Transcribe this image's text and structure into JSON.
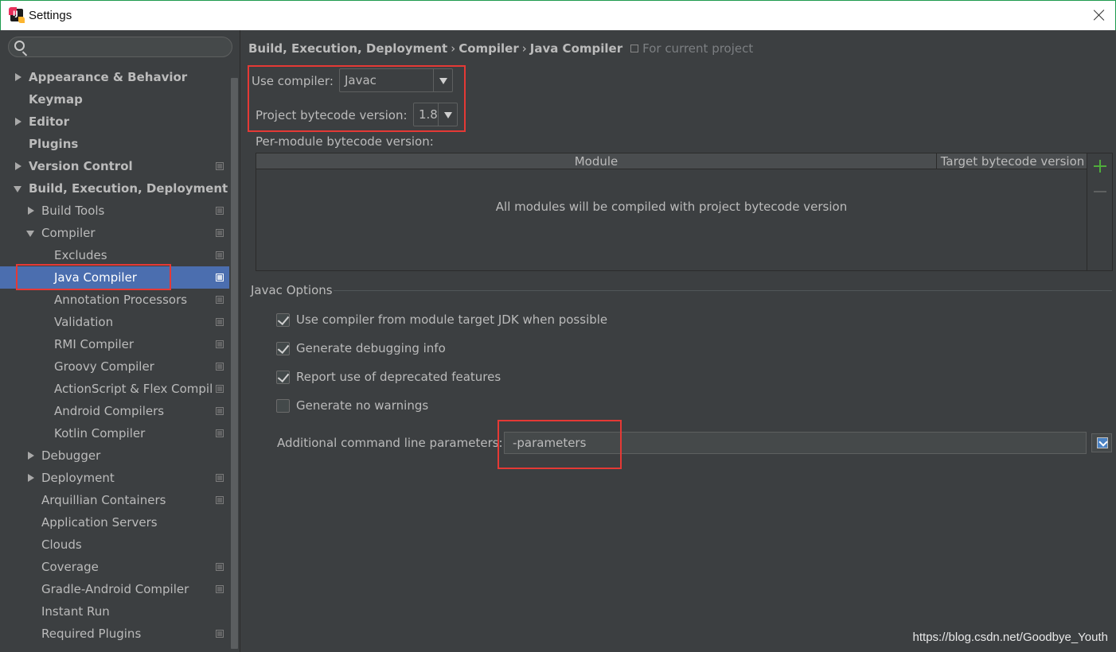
{
  "window": {
    "title": "Settings"
  },
  "search": {
    "placeholder": ""
  },
  "tree": [
    {
      "label": "Appearance & Behavior",
      "level": 0,
      "arrow": "right",
      "bold": true,
      "project": false
    },
    {
      "label": "Keymap",
      "level": 0,
      "arrow": "",
      "bold": true,
      "project": false
    },
    {
      "label": "Editor",
      "level": 0,
      "arrow": "right",
      "bold": true,
      "project": false
    },
    {
      "label": "Plugins",
      "level": 0,
      "arrow": "",
      "bold": true,
      "project": false
    },
    {
      "label": "Version Control",
      "level": 0,
      "arrow": "right",
      "bold": true,
      "project": true
    },
    {
      "label": "Build, Execution, Deployment",
      "level": 0,
      "arrow": "down",
      "bold": true,
      "project": false
    },
    {
      "label": "Build Tools",
      "level": 1,
      "arrow": "right",
      "bold": false,
      "project": true
    },
    {
      "label": "Compiler",
      "level": 1,
      "arrow": "down",
      "bold": false,
      "project": true
    },
    {
      "label": "Excludes",
      "level": 2,
      "arrow": "",
      "bold": false,
      "project": true
    },
    {
      "label": "Java Compiler",
      "level": 2,
      "arrow": "",
      "bold": false,
      "project": true,
      "selected": true
    },
    {
      "label": "Annotation Processors",
      "level": 2,
      "arrow": "",
      "bold": false,
      "project": true
    },
    {
      "label": "Validation",
      "level": 2,
      "arrow": "",
      "bold": false,
      "project": true
    },
    {
      "label": "RMI Compiler",
      "level": 2,
      "arrow": "",
      "bold": false,
      "project": true
    },
    {
      "label": "Groovy Compiler",
      "level": 2,
      "arrow": "",
      "bold": false,
      "project": true
    },
    {
      "label": "ActionScript & Flex Compil",
      "level": 2,
      "arrow": "",
      "bold": false,
      "project": true
    },
    {
      "label": "Android Compilers",
      "level": 2,
      "arrow": "",
      "bold": false,
      "project": true
    },
    {
      "label": "Kotlin Compiler",
      "level": 2,
      "arrow": "",
      "bold": false,
      "project": true
    },
    {
      "label": "Debugger",
      "level": 1,
      "arrow": "right",
      "bold": false,
      "project": false
    },
    {
      "label": "Deployment",
      "level": 1,
      "arrow": "right",
      "bold": false,
      "project": true
    },
    {
      "label": "Arquillian Containers",
      "level": 1,
      "arrow": "",
      "bold": false,
      "project": true
    },
    {
      "label": "Application Servers",
      "level": 1,
      "arrow": "",
      "bold": false,
      "project": false
    },
    {
      "label": "Clouds",
      "level": 1,
      "arrow": "",
      "bold": false,
      "project": false
    },
    {
      "label": "Coverage",
      "level": 1,
      "arrow": "",
      "bold": false,
      "project": true
    },
    {
      "label": "Gradle-Android Compiler",
      "level": 1,
      "arrow": "",
      "bold": false,
      "project": true
    },
    {
      "label": "Instant Run",
      "level": 1,
      "arrow": "",
      "bold": false,
      "project": false
    },
    {
      "label": "Required Plugins",
      "level": 1,
      "arrow": "",
      "bold": false,
      "project": true
    }
  ],
  "breadcrumb": {
    "items": [
      "Build, Execution, Deployment",
      "Compiler",
      "Java Compiler"
    ],
    "separator": "›",
    "scope": "For current project"
  },
  "compiler": {
    "use_compiler_label": "Use compiler:",
    "use_compiler_value": "Javac",
    "bytecode_label": "Project bytecode version:",
    "bytecode_value": "1.8",
    "per_module_label": "Per-module bytecode version:"
  },
  "module_table": {
    "columns": [
      "Module",
      "Target bytecode version"
    ],
    "empty_text": "All modules will be compiled with project bytecode version"
  },
  "javac_options": {
    "title": "Javac Options",
    "checkboxes": [
      {
        "label": "Use compiler from module target JDK when possible",
        "checked": true
      },
      {
        "label": "Generate debugging info",
        "checked": true
      },
      {
        "label": "Report use of deprecated features",
        "checked": true
      },
      {
        "label": "Generate no warnings",
        "checked": false
      }
    ],
    "params_label": "Additional command line parameters:",
    "params_value": "-parameters"
  },
  "watermark": "https://blog.csdn.net/Goodbye_Youth",
  "colors": {
    "background": "#3c3f41",
    "selection": "#4b6eaf",
    "highlight": "#e53935",
    "add": "#4fad3b"
  }
}
